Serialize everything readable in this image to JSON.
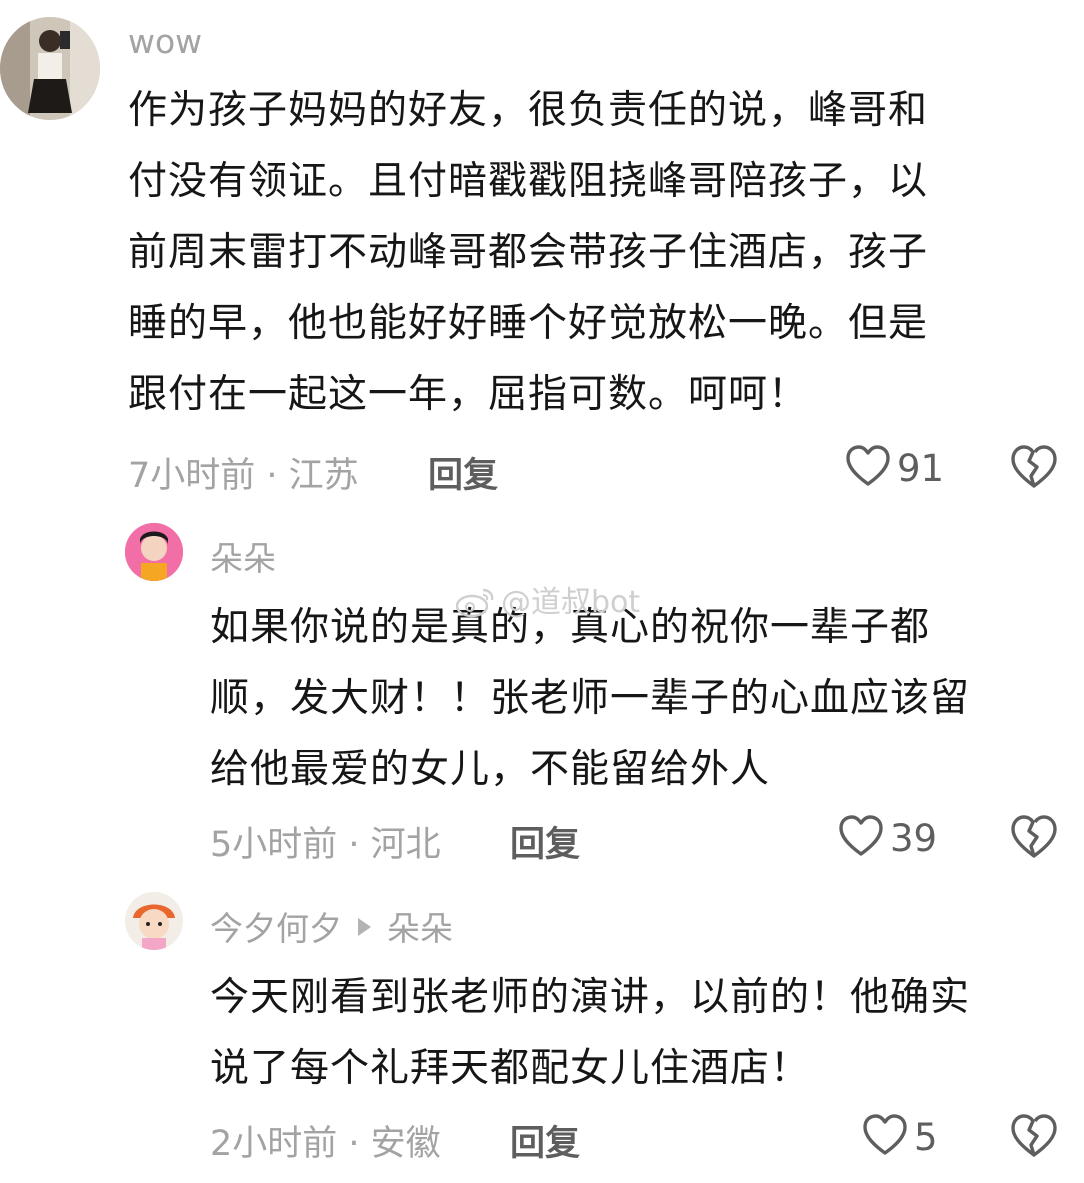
{
  "comments": [
    {
      "username": "wow",
      "lines": [
        "作为孩子妈妈的好友，很负责任的说，峰哥和",
        "付没有领证。且付暗戳戳阻挠峰哥陪孩子，以",
        "前周末雷打不动峰哥都会带孩子住酒店，孩子",
        "睡的早，他也能好好睡个好觉放松一晚。但是",
        "跟付在一起这一年，屈指可数。呵呵！"
      ],
      "meta": "7小时前 · 江苏",
      "reply_label": "回复",
      "likes": "91"
    },
    {
      "username": "朵朵",
      "lines": [
        "如果你说的是真的，真心的祝你一辈子都",
        "顺，发大财！！张老师一辈子的心血应该留",
        "给他最爱的女儿，不能留给外人"
      ],
      "meta": "5小时前 · 河北",
      "reply_label": "回复",
      "likes": "39"
    },
    {
      "username": "今夕何夕",
      "reply_to": "朵朵",
      "lines": [
        "今天刚看到张老师的演讲，以前的！他确实",
        "说了每个礼拜天都配女儿住酒店！"
      ],
      "meta": "2小时前 · 安徽",
      "reply_label": "回复",
      "likes": "5"
    }
  ],
  "watermark": "@道叔bot",
  "colors": {
    "text": "#161616",
    "meta": "#a3a3a3",
    "icon": "#5e5e5e",
    "background": "#ffffff"
  }
}
